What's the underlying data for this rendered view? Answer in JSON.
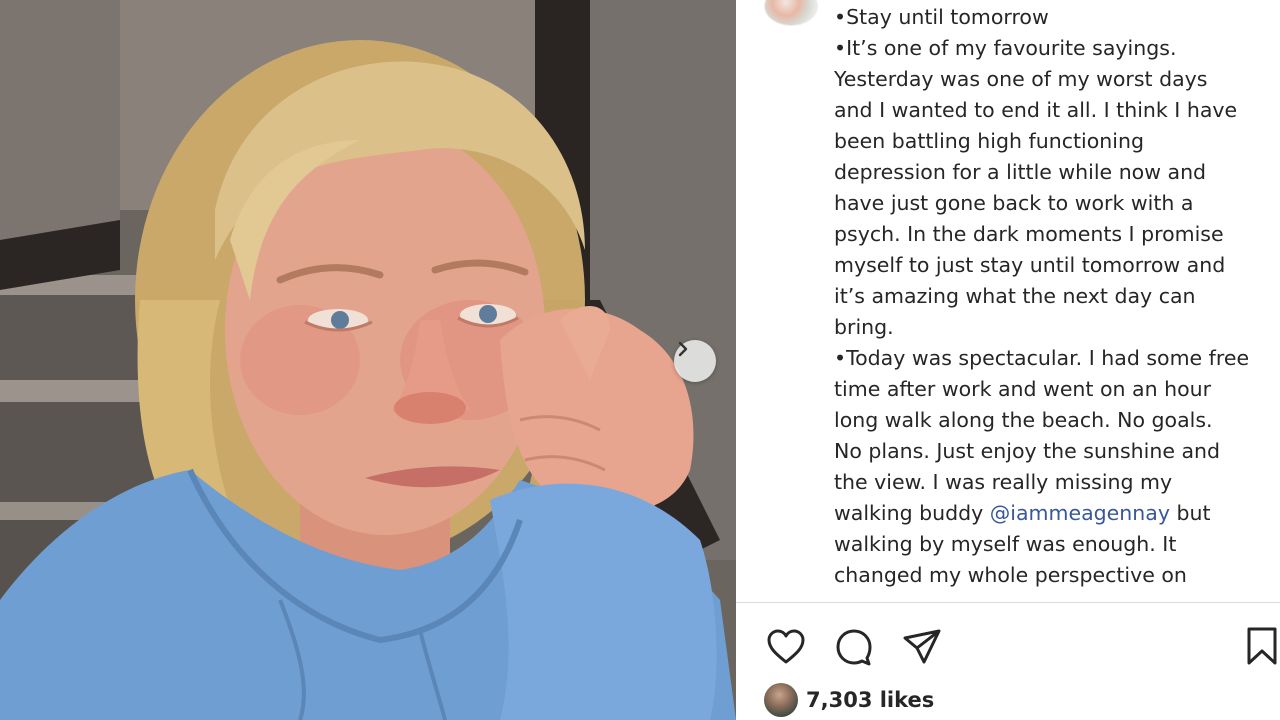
{
  "post": {
    "caption_lines": [
      "•Stay until tomorrow",
      "•It’s one of my favourite sayings.",
      "Yesterday was one of my worst days",
      "and I wanted to end it all. I think I have",
      "been battling high functioning",
      "depression for a little while now and",
      "have just gone back to work with a",
      "psych. In the dark moments I promise",
      "myself to just stay until tomorrow and",
      "it’s amazing what the next day can",
      "bring.",
      "•Today was spectacular. I had some free",
      "time after work and went on an hour",
      "long walk along the beach. No goals.",
      "No plans. Just enjoy the sunshine and",
      "the view. I was really missing my"
    ],
    "mention_line": {
      "before": "walking buddy ",
      "mention": "@iammeagennay",
      "after": " but"
    },
    "caption_lines_end": [
      "walking by myself was enough. It",
      "changed my whole perspective on"
    ],
    "likes": "7,303 likes"
  },
  "icons": {
    "next": "chevron-right-icon",
    "like": "heart-icon",
    "comment": "comment-icon",
    "share": "send-icon",
    "save": "bookmark-icon"
  },
  "colors": {
    "mention": "#385898",
    "hoodie": "#6f9ed3",
    "hair": "#d9b97a"
  }
}
